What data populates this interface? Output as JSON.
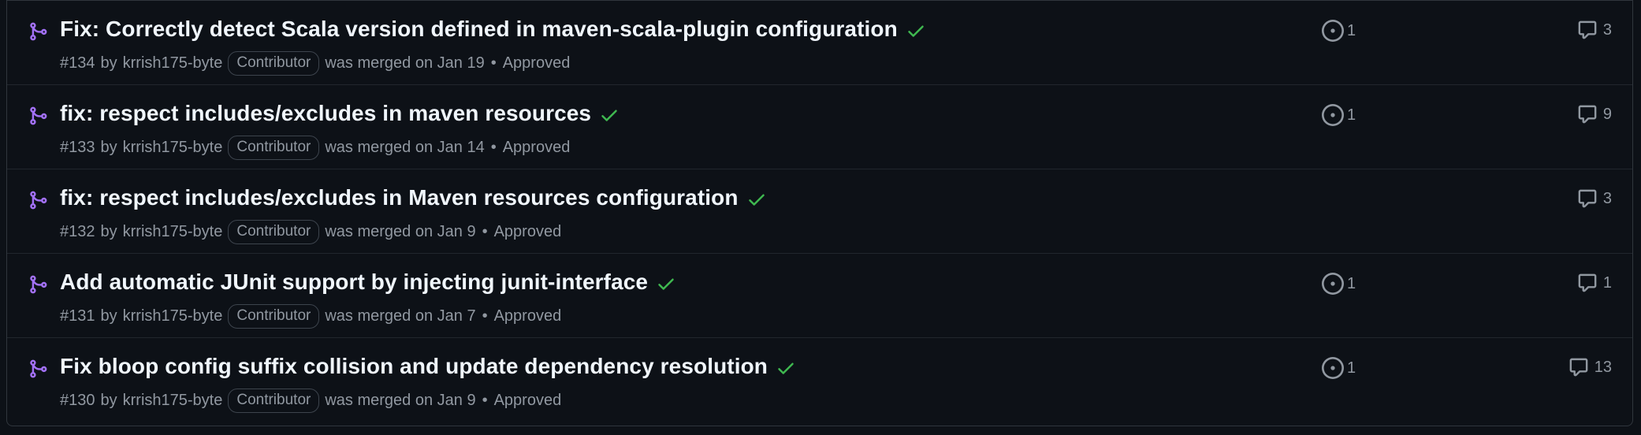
{
  "colors": {
    "background": "#0d1117",
    "merged_icon": "#a371f7",
    "check": "#3fb950",
    "muted_text": "#9198a1",
    "title_text": "#f0f6fc"
  },
  "icons": {
    "merged": "git-merge-icon",
    "check": "check-icon",
    "linked_issue": "issue-opened-icon",
    "comments": "comment-icon"
  },
  "pull_requests": [
    {
      "title": "Fix: Correctly detect Scala version defined in maven-scala-plugin configuration",
      "number": "#134",
      "by": "by",
      "author": "krrish175-byte",
      "role": "Contributor",
      "merged_text": "was merged on Jan 19",
      "separator": "•",
      "review": "Approved",
      "linked_issues": "1",
      "comments": "3"
    },
    {
      "title": "fix: respect includes/excludes in maven resources",
      "number": "#133",
      "by": "by",
      "author": "krrish175-byte",
      "role": "Contributor",
      "merged_text": "was merged on Jan 14",
      "separator": "•",
      "review": "Approved",
      "linked_issues": "1",
      "comments": "9"
    },
    {
      "title": "fix: respect includes/excludes in Maven resources configuration",
      "number": "#132",
      "by": "by",
      "author": "krrish175-byte",
      "role": "Contributor",
      "merged_text": "was merged on Jan 9",
      "separator": "•",
      "review": "Approved",
      "linked_issues": "",
      "comments": "3"
    },
    {
      "title": "Add automatic JUnit support by injecting junit-interface",
      "number": "#131",
      "by": "by",
      "author": "krrish175-byte",
      "role": "Contributor",
      "merged_text": "was merged on Jan 7",
      "separator": "•",
      "review": "Approved",
      "linked_issues": "1",
      "comments": "1"
    },
    {
      "title": "Fix bloop config suffix collision and update dependency resolution",
      "number": "#130",
      "by": "by",
      "author": "krrish175-byte",
      "role": "Contributor",
      "merged_text": "was merged on Jan 9",
      "separator": "•",
      "review": "Approved",
      "linked_issues": "1",
      "comments": "13"
    }
  ]
}
